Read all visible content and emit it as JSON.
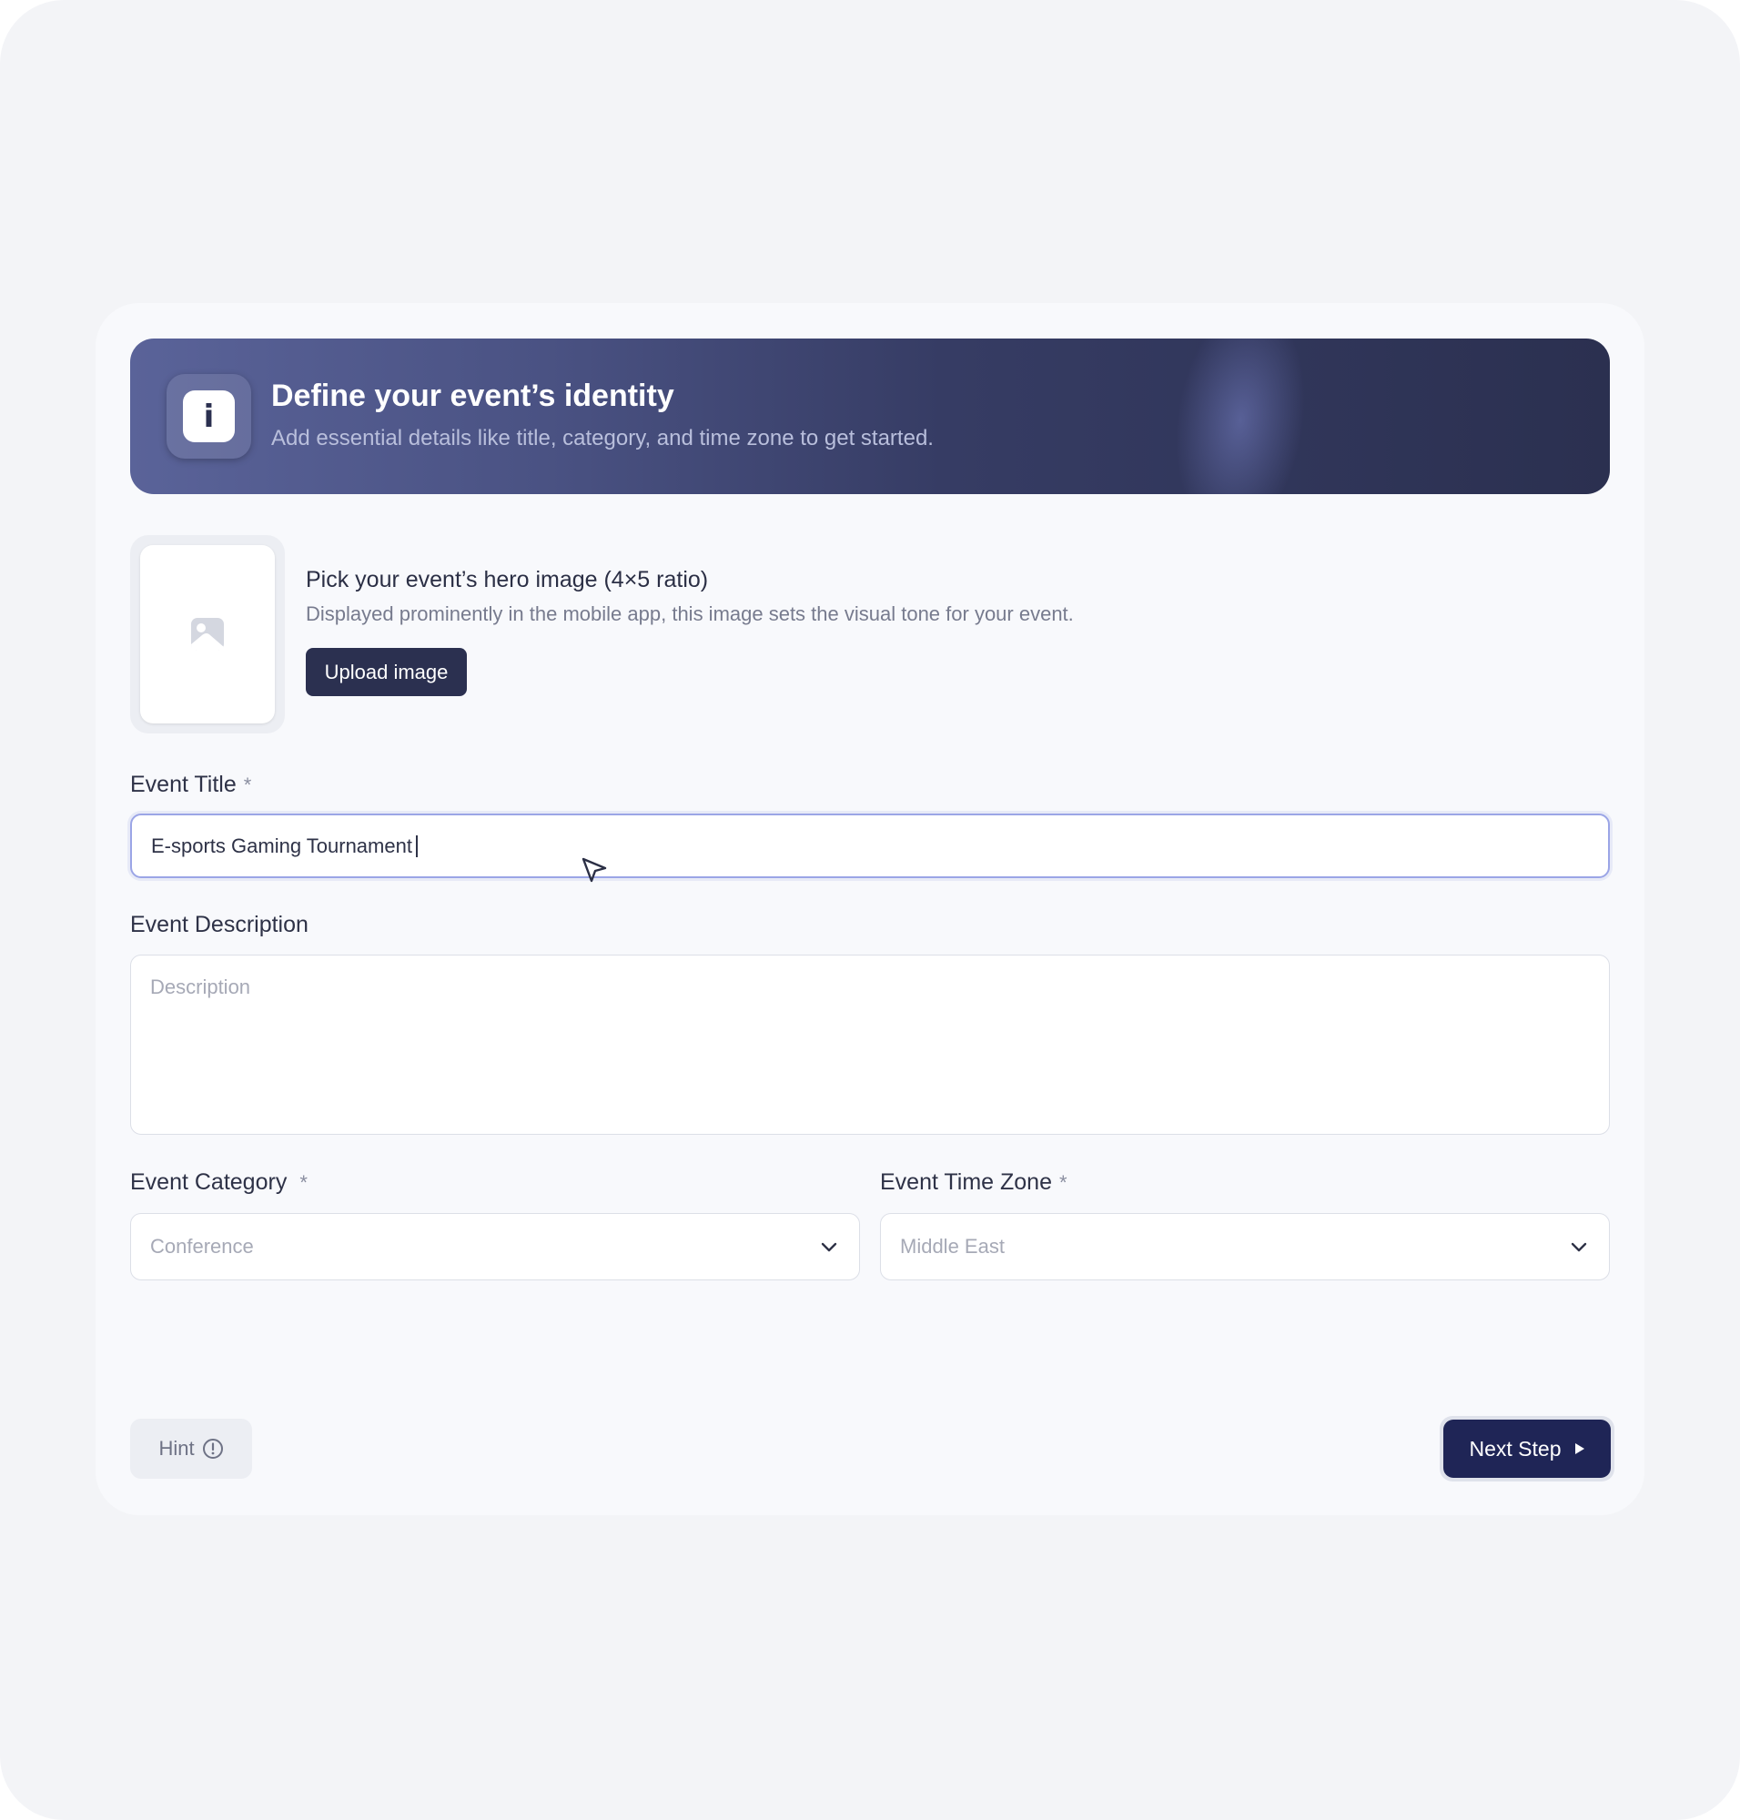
{
  "colors": {
    "banner_dark": "#2b3050",
    "banner_light": "#5a6399",
    "primary_button": "#1f2556",
    "upload_button": "#2b3050",
    "focus_border": "#9ba5e6",
    "card_bg": "#f8f9fc"
  },
  "banner": {
    "icon": "info-icon",
    "title": "Define your event’s identity",
    "subtitle": "Add essential details like title, category, and time zone to get started."
  },
  "hero": {
    "icon": "image-placeholder-icon",
    "title": "Pick your event’s hero image (4×5 ratio)",
    "description": "Displayed prominently in the mobile app, this image sets the visual tone for your event.",
    "upload_label": "Upload image"
  },
  "form": {
    "title_label": "Event Title",
    "title_value": "E-sports Gaming Tournament",
    "required_mark": "*",
    "description_label": "Event Description",
    "description_placeholder": "Description",
    "category_label": "Event Category",
    "category_value": "Conference",
    "timezone_label": "Event Time Zone",
    "timezone_value": "Middle East"
  },
  "footer": {
    "hint_label": "Hint",
    "hint_icon": "info-circle-icon",
    "next_label": "Next Step",
    "next_icon": "play-arrow-icon"
  }
}
